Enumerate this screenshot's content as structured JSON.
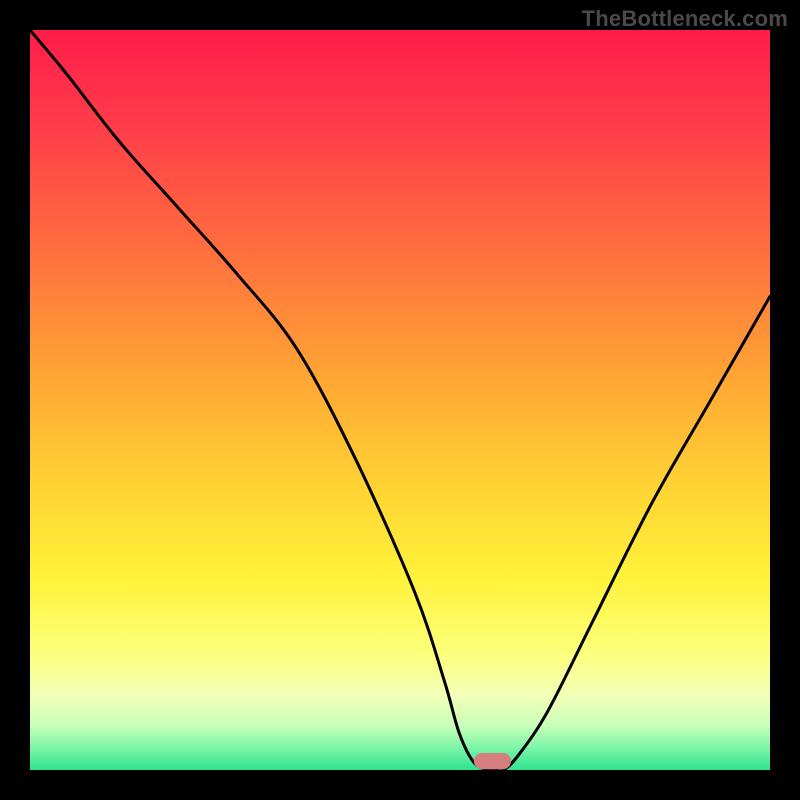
{
  "watermark": "TheBottleneck.com",
  "chart_data": {
    "type": "line",
    "title": "",
    "xlabel": "",
    "ylabel": "",
    "xlim": [
      0,
      100
    ],
    "ylim": [
      0,
      100
    ],
    "grid": false,
    "legend": false,
    "series": [
      {
        "name": "bottleneck-curve",
        "x": [
          0,
          5,
          12,
          20,
          28,
          36,
          44,
          52,
          56,
          58,
          60,
          62,
          63,
          64,
          66,
          70,
          76,
          84,
          92,
          100
        ],
        "y": [
          100,
          94,
          85,
          76,
          67,
          57,
          42,
          24,
          12,
          5,
          1,
          0,
          0,
          0,
          2,
          8,
          20,
          36,
          50,
          64
        ]
      }
    ],
    "marker": {
      "name": "optimal-pill",
      "x": 62.5,
      "y": 1.2,
      "width": 5,
      "height": 2.2,
      "color": "#d57d7f"
    },
    "background_gradient": {
      "stops": [
        {
          "offset": 0.0,
          "color": "#ff1c4a"
        },
        {
          "offset": 0.12,
          "color": "#ff3a4a"
        },
        {
          "offset": 0.3,
          "color": "#ff6f3e"
        },
        {
          "offset": 0.48,
          "color": "#ffa934"
        },
        {
          "offset": 0.62,
          "color": "#ffd433"
        },
        {
          "offset": 0.74,
          "color": "#fff23a"
        },
        {
          "offset": 0.84,
          "color": "#fdff7a"
        },
        {
          "offset": 0.9,
          "color": "#f2ffb8"
        },
        {
          "offset": 0.94,
          "color": "#c8ffb9"
        },
        {
          "offset": 0.97,
          "color": "#7cf5a8"
        },
        {
          "offset": 1.0,
          "color": "#2fe38f"
        }
      ]
    }
  }
}
